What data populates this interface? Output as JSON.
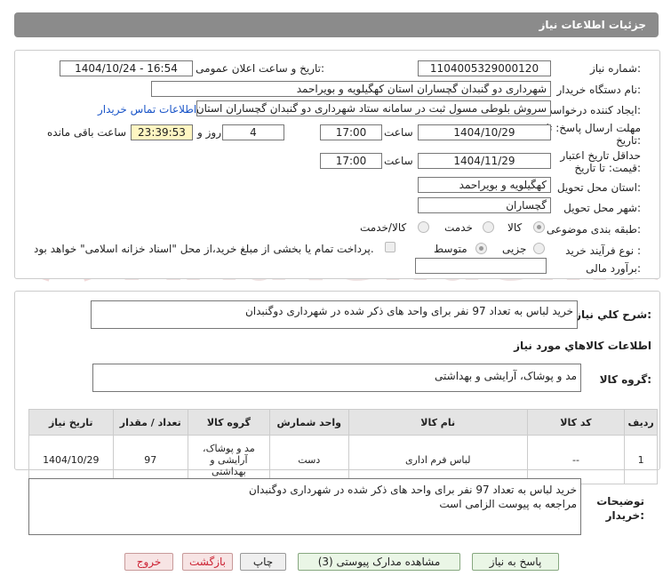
{
  "header": {
    "title": "جزئیات اطلاعات نیاز"
  },
  "watermark": {
    "text": "AriaTender.neT"
  },
  "form": {
    "need_number_label": "شماره نیاز:",
    "need_number": "1104005329000120",
    "announce_label": "تاریخ و ساعت اعلان عمومی:",
    "announce_value": "1404/10/24 - 16:54",
    "buyer_org_label": "نام دستگاه خریدار:",
    "buyer_org": "شهرداری دو گنبدان گچساران استان کهگیلویه و بویراحمد",
    "creator_label": "ایجاد کننده درخواست:",
    "creator": "سروش بلوطی مسول ثبت در سامانه ستاد شهرداری دو گنبدان گچساران استان",
    "contact_link": "اطلاعات تماس خریدار",
    "deadline_label_1": "مهلت ارسال پاسخ: تا",
    "deadline_label_2": "تاریخ:",
    "deadline_date": "1404/10/29",
    "time_label": "ساعت",
    "deadline_time": "17:00",
    "days_value": "4",
    "days_label": "روز و",
    "remaining_time": "23:39:53",
    "remaining_label": "ساعت باقی مانده",
    "validity_label_1": "حداقل تاریخ اعتبار",
    "validity_label_2": "قیمت: تا تاریخ:",
    "validity_date": "1404/11/29",
    "validity_time_label": "ساعت",
    "validity_time": "17:00",
    "province_label": "استان محل تحویل:",
    "province": "کهگیلویه و بویراحمد",
    "city_label": "شهر محل تحویل:",
    "city": "گچساران",
    "category_label": "طبقه بندی موضوعی:",
    "category_options": [
      "کالا",
      "خدمت",
      "کالا/خدمت"
    ],
    "process_label": "نوع فرآیند خرید :",
    "process_options": [
      "جزیی",
      "متوسط"
    ],
    "payment_note": "پرداخت تمام یا بخشی از مبلغ خرید،از محل \"اسناد خزانه اسلامی\" خواهد بود.",
    "estimate_label": "برآورد مالی:",
    "estimate_value": ""
  },
  "summary": {
    "label": "شرح کلي نياز:",
    "text": "خرید لباس به تعداد 97 نفر برای واحد های ذکر شده در شهرداری دوگنبدان"
  },
  "goods": {
    "section_title": "اطلاعات کالاهاي مورد نياز",
    "group_label": "گروه کالا:",
    "group_value": "مد و پوشاک، آرایشی و بهداشتی",
    "table": {
      "headers": [
        "ردیف",
        "کد کالا",
        "نام کالا",
        "واحد شمارش",
        "گروه کالا",
        "تعداد / مقدار",
        "تاریخ نیاز"
      ],
      "rows": [
        [
          "1",
          "--",
          "لباس فرم اداری",
          "دست",
          "مد و پوشاک، آرایشی و بهداشتی",
          "97",
          "1404/10/29"
        ]
      ]
    }
  },
  "buyer_notes": {
    "label_1": "توضیحات",
    "label_2": "خریدار:",
    "line1": "خرید لباس به تعداد 97 نفر برای واحد های ذکر شده در شهرداری دوگنبدان",
    "line2": "مراجعه به پیوست الزامی است"
  },
  "buttons": {
    "reply": "پاسخ به نیاز",
    "view_docs": "مشاهده مدارک پیوستی (3)",
    "print": "چاپ",
    "back": "بازگشت",
    "exit": "خروج"
  }
}
